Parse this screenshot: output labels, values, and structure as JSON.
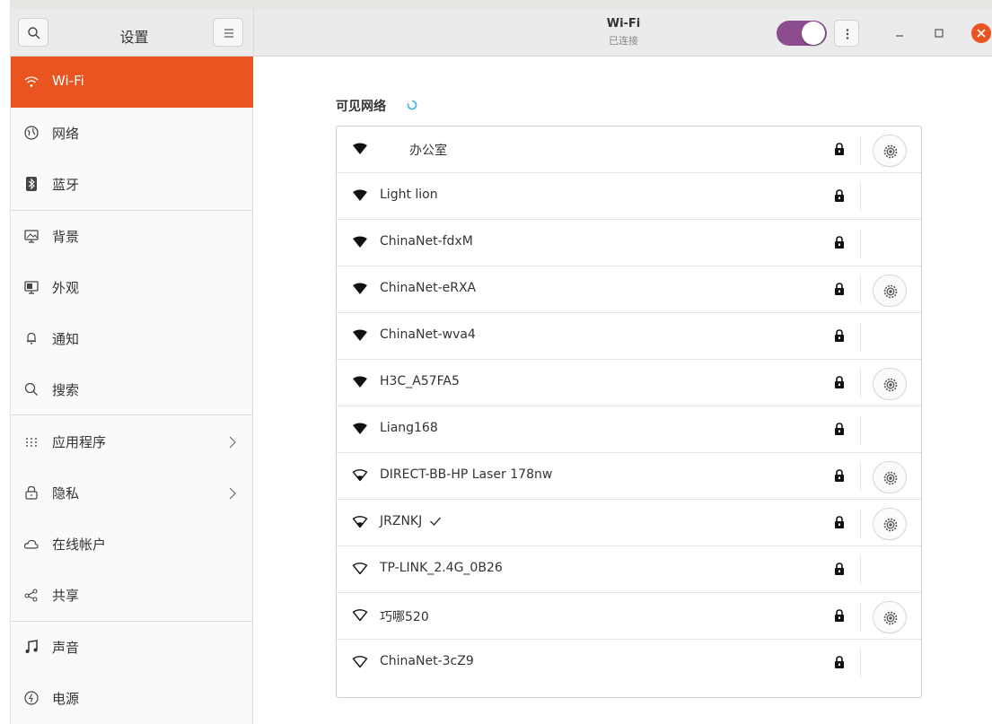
{
  "sidebar": {
    "title": "设置",
    "items": [
      {
        "label": "Wi-Fi",
        "icon": "wifi-icon",
        "active": true
      },
      {
        "label": "网络",
        "icon": "network-icon"
      },
      {
        "label": "蓝牙",
        "icon": "bluetooth-icon"
      },
      {
        "label": "背景",
        "icon": "background-icon"
      },
      {
        "label": "外观",
        "icon": "appearance-icon"
      },
      {
        "label": "通知",
        "icon": "bell-icon"
      },
      {
        "label": "搜索",
        "icon": "search-icon"
      },
      {
        "label": "应用程序",
        "icon": "apps-grid-icon",
        "has_submenu": true
      },
      {
        "label": "隐私",
        "icon": "lock-icon",
        "has_submenu": true
      },
      {
        "label": "在线帐户",
        "icon": "cloud-icon"
      },
      {
        "label": "共享",
        "icon": "share-icon"
      },
      {
        "label": "声音",
        "icon": "music-note-icon"
      },
      {
        "label": "电源",
        "icon": "power-icon"
      }
    ]
  },
  "header": {
    "title": "Wi-Fi",
    "subtitle": "已连接",
    "wifi_enabled": true
  },
  "main": {
    "section_title": "可见网络",
    "networks": [
      {
        "name": "办公室",
        "signal": "full",
        "secured": true,
        "settings": true
      },
      {
        "name": "Light lion",
        "signal": "full",
        "secured": true,
        "settings": false
      },
      {
        "name": "ChinaNet-fdxM",
        "signal": "full",
        "secured": true,
        "settings": false
      },
      {
        "name": "ChinaNet-eRXA",
        "signal": "full",
        "secured": true,
        "settings": true
      },
      {
        "name": "ChinaNet-wva4",
        "signal": "full",
        "secured": true,
        "settings": false
      },
      {
        "name": "H3C_A57FA5",
        "signal": "full",
        "secured": true,
        "settings": true
      },
      {
        "name": "Liang168",
        "signal": "full",
        "secured": true,
        "settings": false
      },
      {
        "name": "DIRECT-BB-HP Laser 178nw",
        "signal": "weak",
        "secured": true,
        "settings": true
      },
      {
        "name": "JRZNKJ",
        "signal": "weak",
        "secured": true,
        "settings": true,
        "connected": true
      },
      {
        "name": "TP-LINK_2.4G_0B26",
        "signal": "weak",
        "secured": true,
        "settings": false
      },
      {
        "name": "巧哪520",
        "signal": "weak",
        "secured": true,
        "settings": true
      },
      {
        "name": "ChinaNet-3cZ9",
        "signal": "weak",
        "secured": true,
        "settings": false
      }
    ]
  },
  "colors": {
    "accent": "#e95420",
    "toggle": "#8b4d8f",
    "spinner": "#3daee9"
  }
}
